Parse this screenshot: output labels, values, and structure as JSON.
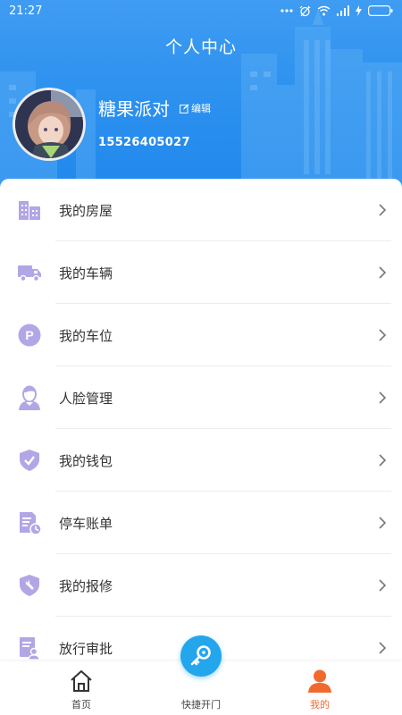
{
  "status_bar": {
    "time": "21:27",
    "icons": [
      "more-dots-icon",
      "alarm-icon",
      "wifi-icon",
      "signal-icon",
      "charging-icon",
      "battery-icon"
    ]
  },
  "header": {
    "title": "个人中心"
  },
  "profile": {
    "name": "糖果派对",
    "edit_label": "编辑",
    "phone": "15526405027"
  },
  "colors": {
    "header_blue": "#2a8fee",
    "icon_purple": "#b3a6e6",
    "active_orange": "#f06a2e",
    "quick_blue": "#24a6ec"
  },
  "menu": {
    "items": [
      {
        "label": "我的房屋",
        "icon": "building-icon"
      },
      {
        "label": "我的车辆",
        "icon": "truck-icon"
      },
      {
        "label": "我的车位",
        "icon": "parking-icon"
      },
      {
        "label": "人脸管理",
        "icon": "face-icon"
      },
      {
        "label": "我的钱包",
        "icon": "shield-check-icon"
      },
      {
        "label": "停车账单",
        "icon": "bill-icon"
      },
      {
        "label": "我的报修",
        "icon": "wrench-shield-icon"
      },
      {
        "label": "放行审批",
        "icon": "approval-icon"
      }
    ]
  },
  "bottom_nav": {
    "home_label": "首页",
    "quick_label": "快捷开门",
    "mine_label": "我的",
    "active": "我的"
  }
}
